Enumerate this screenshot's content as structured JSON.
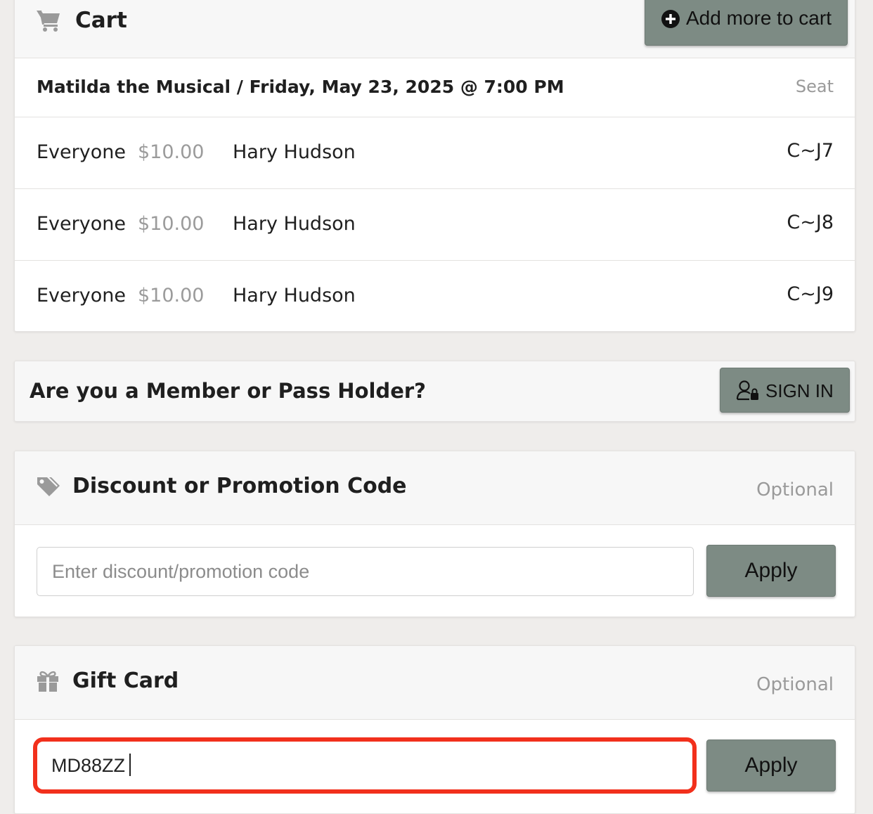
{
  "cart": {
    "title": "Cart",
    "add_more_label": "Add more to cart",
    "event": {
      "title": "Matilda the Musical / Friday, May 23, 2025 @ 7:00 PM",
      "seat_header": "Seat"
    },
    "tickets": [
      {
        "type": "Everyone",
        "price": "$10.00",
        "name": "Hary Hudson",
        "seat": "C~J7"
      },
      {
        "type": "Everyone",
        "price": "$10.00",
        "name": "Hary Hudson",
        "seat": "C~J8"
      },
      {
        "type": "Everyone",
        "price": "$10.00",
        "name": "Hary Hudson",
        "seat": "C~J9"
      }
    ]
  },
  "member": {
    "question": "Are you a Member or Pass Holder?",
    "sign_in_label": "SIGN IN"
  },
  "discount": {
    "title": "Discount or Promotion Code",
    "optional_label": "Optional",
    "placeholder": "Enter discount/promotion code",
    "value": "",
    "apply_label": "Apply"
  },
  "gift_card": {
    "title": "Gift Card",
    "optional_label": "Optional",
    "value": "MD88ZZ",
    "apply_label": "Apply"
  },
  "colors": {
    "button_bg": "#7d8b84",
    "highlight": "#f2301c",
    "price_text": "#9b9b9b",
    "page_bg": "#efedeb"
  },
  "icons": {
    "cart": "shopping-cart-icon",
    "add": "plus-circle-icon",
    "member": "user-lock-icon",
    "discount": "tags-icon",
    "gift": "gift-icon"
  }
}
